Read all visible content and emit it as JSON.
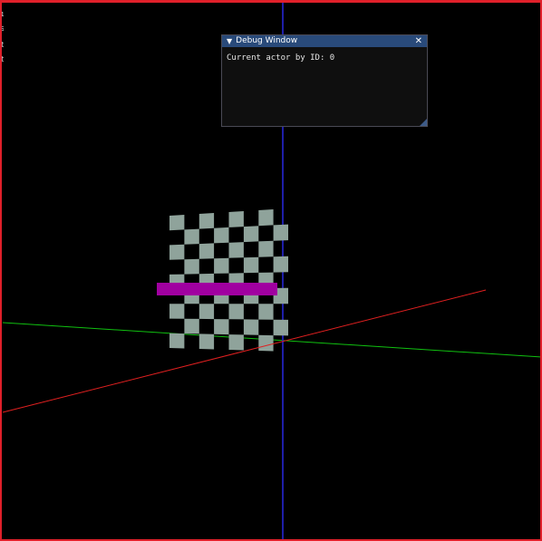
{
  "colors": {
    "frame_border": "#e0202a",
    "background": "#000000",
    "x_axis": "#e02020",
    "y_axis": "#1e1ea8",
    "z_axis": "#10c010",
    "checker_light": "#8fa39b",
    "checker_dark": "#000000",
    "actor_bar": "#a000a0",
    "window_titlebar": "#294a7a",
    "window_bg": "#0f0f0f",
    "window_border": "#4a4a55"
  },
  "debug_window": {
    "title": "Debug Window",
    "collapse_icon": "▼",
    "close_icon": "✕",
    "body_text": "Current actor by ID: 0"
  },
  "scene": {
    "checkerboard": {
      "columns": 8,
      "rows": 9
    },
    "actor_bar_label": ""
  }
}
